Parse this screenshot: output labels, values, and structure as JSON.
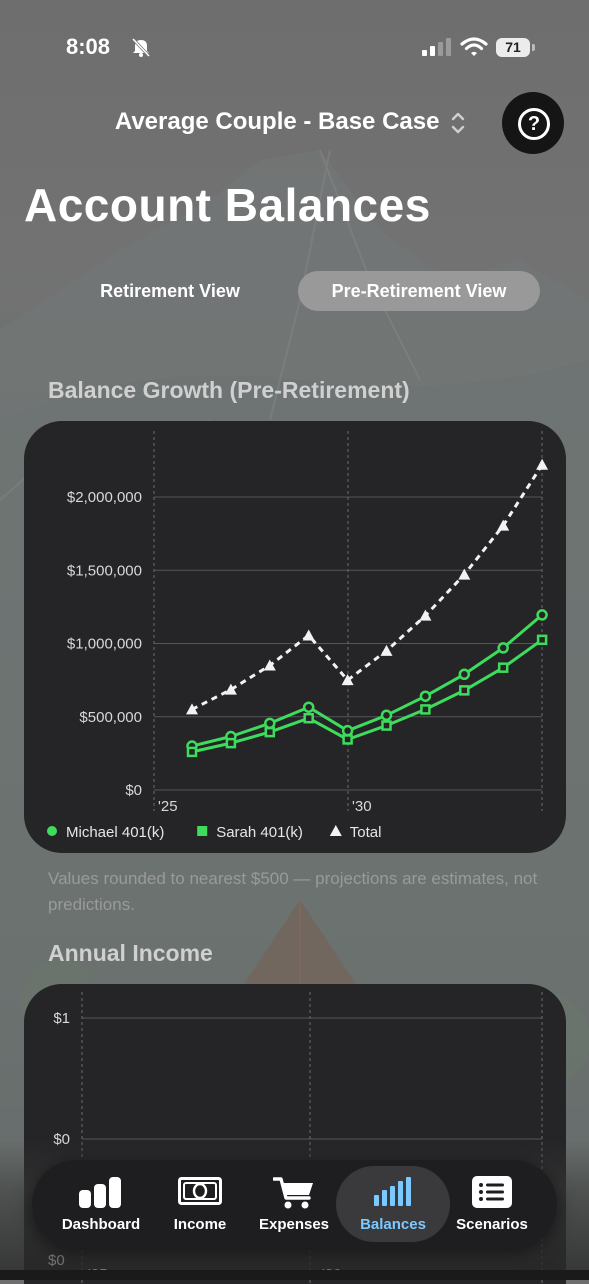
{
  "status_bar": {
    "time": "8:08",
    "battery": "71"
  },
  "header": {
    "scenario": "Average Couple - Base Case",
    "help_icon": "question-circle-icon"
  },
  "page_title": "Account Balances",
  "segmented": {
    "options": [
      "Retirement View",
      "Pre-Retirement View"
    ],
    "selected": "Pre-Retirement View"
  },
  "balance_section": {
    "title": "Balance Growth (Pre-Retirement)",
    "note": "Values rounded to nearest $500 — projections are estimates, not predictions."
  },
  "income_section": {
    "title": "Annual Income"
  },
  "colors": {
    "green": "#3ddc5c",
    "white": "#f2f2f2",
    "accent_blue": "#7cc9ff",
    "card": "#252527"
  },
  "chart_data": [
    {
      "type": "line",
      "title": "Balance Growth (Pre-Retirement)",
      "x": [
        2025,
        2026,
        2027,
        2028,
        2029,
        2030,
        2031,
        2032,
        2033,
        2034,
        2035
      ],
      "x_tick_labels": [
        "'25",
        "'30"
      ],
      "y_tick_labels": [
        "$2,000,000",
        "$1,500,000",
        "$1,000,000",
        "$500,000",
        "$0"
      ],
      "ylim": [
        0,
        2000000
      ],
      "grid": true,
      "legend": "bottom-left",
      "series": [
        {
          "name": "Michael 401(k)",
          "marker": "circle",
          "color": "#3ddc5c",
          "values": [
            300000,
            365000,
            455000,
            565000,
            405000,
            510000,
            640000,
            790000,
            970000,
            1195000
          ]
        },
        {
          "name": "Sarah 401(k)",
          "marker": "square",
          "color": "#3ddc5c",
          "values": [
            260000,
            320000,
            395000,
            490000,
            345000,
            440000,
            550000,
            680000,
            835000,
            1025000
          ]
        },
        {
          "name": "Total",
          "marker": "triangle",
          "color": "#f2f2f2",
          "dashed": true,
          "values": [
            550000,
            685000,
            850000,
            1055000,
            750000,
            950000,
            1190000,
            1470000,
            1805000,
            2220000
          ]
        }
      ]
    },
    {
      "type": "line",
      "title": "Annual Income",
      "y_tick_labels": [
        "$1",
        "$0",
        "$0"
      ],
      "x_tick_labels": [
        "'25",
        "'30"
      ],
      "series": []
    }
  ],
  "tab_bar": {
    "items": [
      {
        "label": "Dashboard",
        "icon": "chart-bars-icon"
      },
      {
        "label": "Income",
        "icon": "banknote-icon"
      },
      {
        "label": "Expenses",
        "icon": "cart-icon"
      },
      {
        "label": "Balances",
        "icon": "bar-chart-icon",
        "active": true
      },
      {
        "label": "Scenarios",
        "icon": "list-icon"
      }
    ]
  }
}
